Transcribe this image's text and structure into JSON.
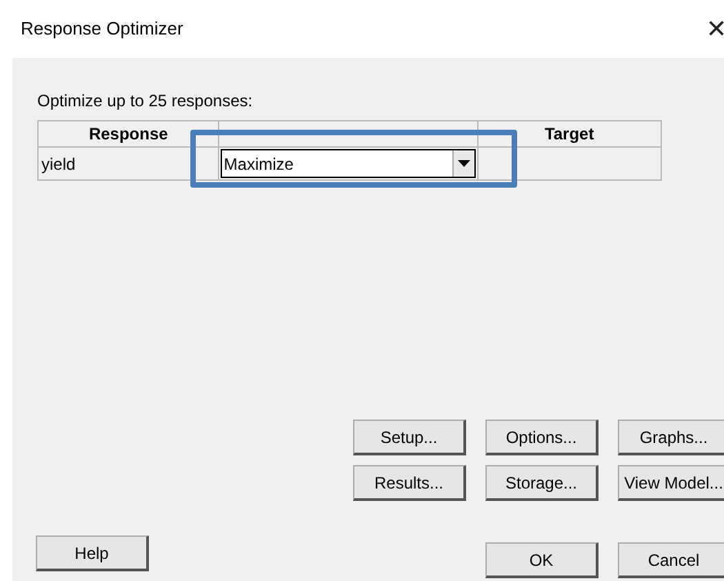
{
  "window": {
    "title": "Response Optimizer",
    "close": "✕"
  },
  "prompt": "Optimize up to 25 responses:",
  "table": {
    "columns": [
      {
        "label": "Response"
      },
      {},
      {
        "label": "Target"
      }
    ],
    "rows": [
      {
        "response": "yield",
        "goal": "Maximize",
        "highlighted": true
      }
    ]
  },
  "buttons": [
    [
      "Setup...",
      "Options...",
      "Graphs..."
    ],
    [
      "Results...",
      "Storage...",
      "View Model..."
    ]
  ],
  "help": "Help",
  "footer": [
    "OK",
    "Cancel"
  ]
}
